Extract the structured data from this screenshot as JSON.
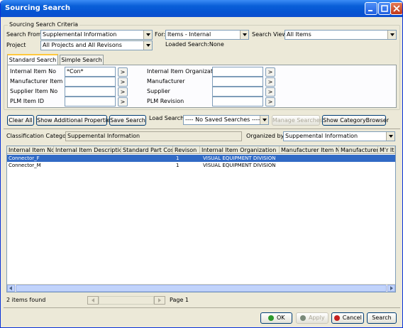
{
  "window": {
    "title": "Sourcing Search",
    "controls": {
      "accent": "#0554d2"
    }
  },
  "criteria": {
    "group_label": "Sourcing Search Criteria",
    "search_from_label": "Search From:",
    "search_from_value": "Supplemental Information",
    "for_label": "For:",
    "for_value": "Items - Internal",
    "search_view_label": "Search View:",
    "search_view_value": "All Items",
    "project_label": "Project",
    "project_value": "All Projects and All Revisons",
    "loaded_search_label": "Loaded Search:None"
  },
  "tabs": [
    {
      "label": "Standard Search",
      "active": true
    },
    {
      "label": "Simple Search",
      "active": false
    }
  ],
  "fields": {
    "internal_item_no_label": "Internal Item No",
    "internal_item_no_value": "*Con*",
    "manufacturer_item_no_label": "Manufacturer Item No",
    "supplier_item_no_label": "Supplier Item No",
    "plm_item_id_label": "PLM Item ID",
    "internal_item_org_label": "Internal Item Organization",
    "manufacturer_label": "Manufacturer",
    "supplier_label": "Supplier",
    "plm_revision_label": "PLM Revision",
    "browse_glyph": ">"
  },
  "toolbar": {
    "clear_all": "Clear All",
    "show_additional": "Show Additional Properties",
    "save_search": "Save Search",
    "load_search_label": "Load Search",
    "load_search_value": "---- No Saved Searches -----",
    "manage_searches": "Manage Searches",
    "show_category_browser": "Show CategoryBrowser"
  },
  "classification": {
    "label": "Classification Category:",
    "value": "Suppemental Information",
    "organized_by_label": "Organized by:",
    "organized_by_value": "Suppemental Information"
  },
  "results": {
    "columns": [
      "Internal Item No",
      "Internal Item Description",
      "Standard Part Cost",
      "Revison",
      "Internal Item Organization",
      "Manufacturer Item No",
      "Manufacturer",
      "M'r It"
    ],
    "rows": [
      {
        "item_no": "Connector_F",
        "revision": "1",
        "organization": "VISUAL EQUIPMENT DIVISION",
        "selected": true
      },
      {
        "item_no": "Connector_M",
        "revision": "1",
        "organization": "VISUAL EQUIPMENT DIVISION",
        "selected": false
      }
    ]
  },
  "status": {
    "items_found": "2 items found",
    "page": "Page 1"
  },
  "footer": {
    "ok": "OK",
    "apply": "Apply",
    "cancel": "Cancel",
    "search": "Search"
  }
}
